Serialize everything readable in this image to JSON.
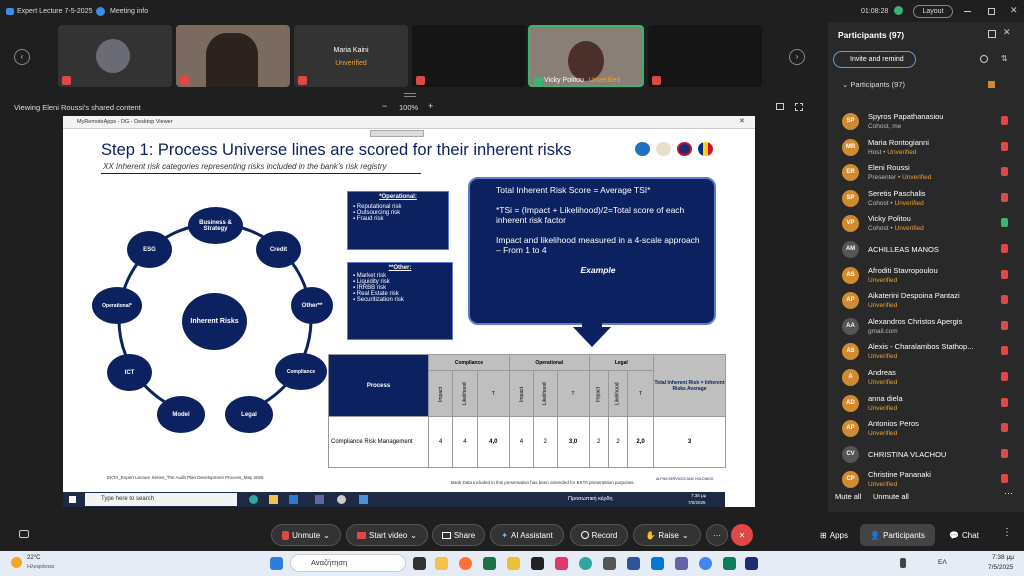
{
  "app": {
    "window_title": "Expert Lecture 7-5-2025",
    "meeting_info": "Meeting info",
    "timer": "01:08:28",
    "layout_label": "Layout"
  },
  "tiles": [
    {
      "name": "Maria Kaini",
      "status": "Unverified"
    },
    {
      "name": "Vicky Politou",
      "status": "Unverified"
    }
  ],
  "share_bar": {
    "label": "Viewing Eleni Roussi's shared content",
    "minus": "−",
    "zoom": "100%",
    "plus": "+"
  },
  "remote_window": {
    "title": "MyRemoteApps - DG - Desktop Viewer"
  },
  "slide": {
    "title": "Step 1: Process Universe lines are scored for their inherent risks",
    "subtitle": "XX Inherent risk categories representing risks included in the bank’s risk registry",
    "center_node": "Inherent Risks",
    "nodes": [
      "Business & Strategy",
      "Credit",
      "Other**",
      "Compliance",
      "Legal",
      "Model",
      "ICT",
      "Operational*",
      "ESG"
    ],
    "operational_box": {
      "header": "*Operational:",
      "items": [
        "Reputational risk",
        "Outsourcing risk",
        "Fraud risk"
      ]
    },
    "other_box": {
      "header": "**Other:",
      "items": [
        "Market risk",
        "Liquidity risk",
        "IRRBB risk",
        "Real Estate risk",
        "Securitization risk"
      ]
    },
    "scroll": {
      "line1": "Total Inherent Risk Score = Average TSI*",
      "line2": "*TSi = (Impact + Likelihood)/2=Total score of each inherent risk factor",
      "line3": "Impact and likelihood measured in a 4-scale approach – From 1 to 4",
      "example": "Example"
    },
    "table": {
      "process_header": "Process",
      "groups": [
        "Compliance",
        "Operational",
        "Legal"
      ],
      "sub_headers": [
        "Impact",
        "Likelihood",
        "T"
      ],
      "total_header": "Total Inherent Risk = Inherent Risks Average",
      "row": {
        "process": "Compliance Risk Management",
        "values": [
          "4",
          "4",
          "4,0",
          "4",
          "2",
          "3,0",
          "2",
          "2",
          "2,0"
        ],
        "total": "3"
      }
    },
    "footer_left": "EKTA_Expert Lecture Series_The Audit Plan Development Process_May 2025",
    "footer_right": "Bank Data included in this presentation has been amended for EKTA presentation purposes.",
    "footer_logo": "ALPHA SERVICES AND HOLDINGS"
  },
  "remote_taskbar": {
    "search": "Type here to search",
    "app_label": "Προσωπική κέρδη",
    "time": "7:38 μμ",
    "date": "7/5/2025"
  },
  "panel": {
    "title": "Participants (97)",
    "invite_label": "Invite and remind",
    "section_label": "Participants (97)",
    "participants": [
      {
        "initials": "SP",
        "name": "Spyros Papathanasiou",
        "role": "Cohost, me",
        "status": "",
        "mic": "off"
      },
      {
        "initials": "MR",
        "name": "Maria Rontogianni",
        "role": "Host",
        "status": "Unverified",
        "mic": "off"
      },
      {
        "initials": "ER",
        "name": "Eleni Roussi",
        "role": "Presenter",
        "status": "Unverified",
        "mic": "off"
      },
      {
        "initials": "SP",
        "name": "Seretis Paschalis",
        "role": "Cohost",
        "status": "Unverified",
        "mic": "off"
      },
      {
        "initials": "VP",
        "name": "Vicky Politou",
        "role": "Cohost",
        "status": "Unverified",
        "mic": "on"
      },
      {
        "initials": "AM",
        "name": "ACHILLEAS MANOS",
        "role": "",
        "status": "",
        "mic": "off"
      },
      {
        "initials": "AS",
        "name": "Afroditi Stavropoulou",
        "role": "",
        "status": "Unverified",
        "mic": "off"
      },
      {
        "initials": "AP",
        "name": "Aikaterini Despoina Pantazi",
        "role": "",
        "status": "Unverified",
        "mic": "off"
      },
      {
        "initials": "AA",
        "name": "Alexandros Christos Apergis",
        "role": "gmail.com",
        "status": "",
        "mic": "off"
      },
      {
        "initials": "AS",
        "name": "Alexis - Charalambos Stathop...",
        "role": "",
        "status": "Unverified",
        "mic": "off"
      },
      {
        "initials": "A",
        "name": "Andreas",
        "role": "",
        "status": "Unverified",
        "mic": "off"
      },
      {
        "initials": "AD",
        "name": "anna diela",
        "role": "",
        "status": "Unverified",
        "mic": "off"
      },
      {
        "initials": "AP",
        "name": "Antonios Peros",
        "role": "",
        "status": "Unverified",
        "mic": "off"
      },
      {
        "initials": "CV",
        "name": "CHRISTINA VLACHOU",
        "role": "",
        "status": "",
        "mic": "off"
      },
      {
        "initials": "CP",
        "name": "Christine Pananaki",
        "role": "",
        "status": "Unverified",
        "mic": "off"
      }
    ],
    "mute_all": "Mute all",
    "unmute_all": "Unmute all"
  },
  "controls": {
    "unmute": "Unmute",
    "start_video": "Start video",
    "share": "Share",
    "ai_assistant": "AI Assistant",
    "record": "Record",
    "raise": "Raise",
    "more": "···",
    "apps": "Apps",
    "participants": "Participants",
    "chat": "Chat"
  },
  "taskbar": {
    "weather_temp": "22°C",
    "weather_desc": "Ηλιοφάνεια",
    "search": "Αναζήτηση",
    "lang": "ΕΛ",
    "time": "7:38 μμ",
    "date": "7/5/2025"
  },
  "colors": {
    "accent": "#0c2260",
    "panel_bg": "#292929",
    "unverified": "#f0a030",
    "end_call": "#e04848"
  }
}
